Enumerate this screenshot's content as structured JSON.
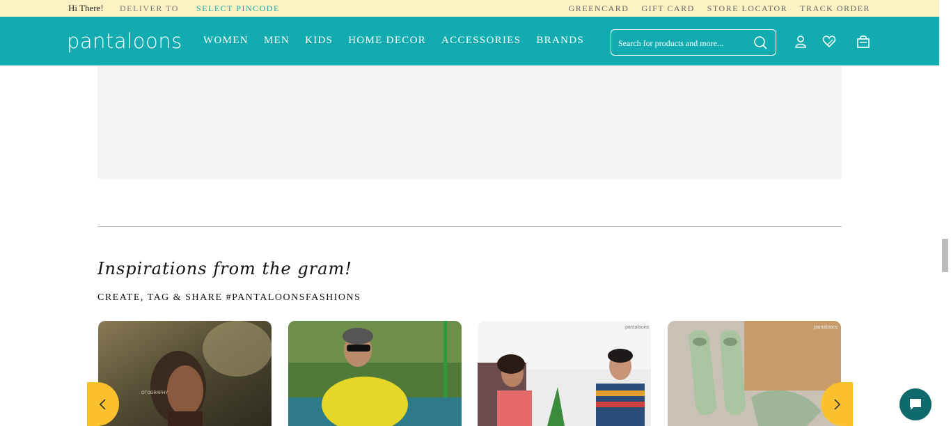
{
  "topbar": {
    "greeting": "Hi There!",
    "deliver_to": "DELIVER TO",
    "pincode": "SELECT PINCODE",
    "links": [
      "GREENCARD",
      "GIFT CARD",
      "STORE LOCATOR",
      "TRACK ORDER"
    ]
  },
  "header": {
    "logo": "pantaloons",
    "nav": [
      "WOMEN",
      "MEN",
      "KIDS",
      "HOME DECOR",
      "ACCESSORIES",
      "BRANDS"
    ],
    "search_placeholder": "Search for products and more...",
    "icons": [
      "account-icon",
      "wishlist-heart-icon",
      "cart-bag-icon"
    ]
  },
  "inspirations": {
    "title": "Inspirations from the gram!",
    "subtitle": "CREATE, TAG & SHARE #PANTALOONSFASHIONS",
    "cards": [
      {
        "watermark": "OTOGRAPHY"
      },
      {
        "watermark": ""
      },
      {
        "watermark": "pantaloons"
      },
      {
        "watermark": "pantaloons"
      }
    ]
  },
  "colors": {
    "brand_teal": "#12acb0",
    "top_strip": "#fbf1c2",
    "arrow_yellow": "#fbc02d",
    "chat_teal": "#0e6a6c"
  }
}
